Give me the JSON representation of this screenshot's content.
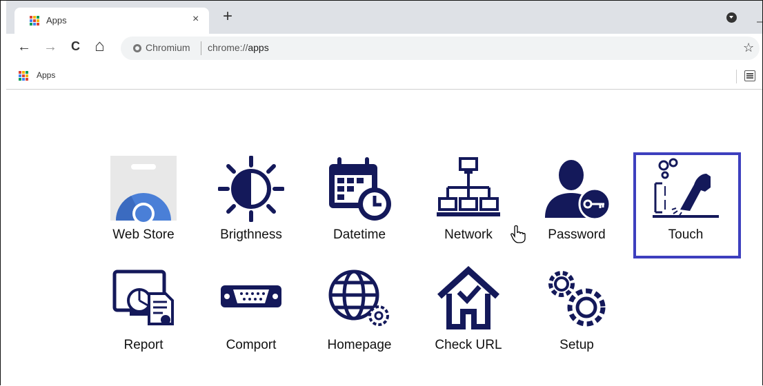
{
  "browser": {
    "tab_title": "Apps",
    "close_glyph": "×",
    "new_tab_glyph": "+",
    "omnibox_label": "Chromium",
    "url_scheme": "chrome://",
    "url_path": "apps",
    "bookmark_label": "Apps"
  },
  "icons": {
    "back": "←",
    "forward": "→",
    "reload": "C",
    "home": "⌂",
    "star": "☆",
    "minimize": "–"
  },
  "apps_row1": [
    {
      "label": "Web Store",
      "icon": "webstore-icon"
    },
    {
      "label": "Brigthness",
      "icon": "brightness-icon"
    },
    {
      "label": "Datetime",
      "icon": "calendar-clock-icon"
    },
    {
      "label": "Network",
      "icon": "network-icon"
    },
    {
      "label": "Password",
      "icon": "user-key-icon"
    },
    {
      "label": "Touch",
      "icon": "touch-icon",
      "selected": true
    }
  ],
  "apps_row2": [
    {
      "label": "Report",
      "icon": "report-icon"
    },
    {
      "label": "Comport",
      "icon": "serial-port-icon"
    },
    {
      "label": "Homepage",
      "icon": "globe-gear-icon"
    },
    {
      "label": "Check URL",
      "icon": "house-check-icon"
    },
    {
      "label": "Setup",
      "icon": "gears-icon"
    }
  ],
  "colors": {
    "icon_navy": "#14195a",
    "selection_border": "#3d3fbe",
    "webstore_blue": "#4a7fd7"
  }
}
